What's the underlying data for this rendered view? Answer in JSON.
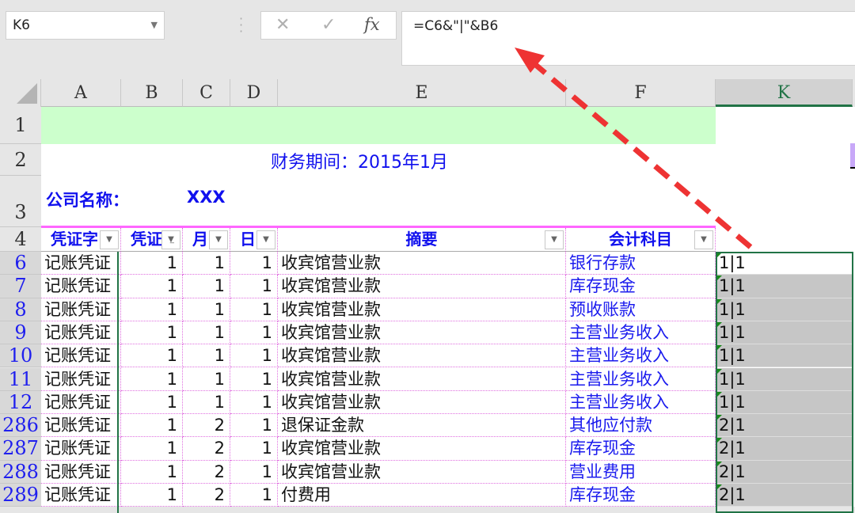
{
  "formula_bar": {
    "name_box": "K6",
    "cancel_icon": "✕",
    "enter_icon": "✓",
    "fx_label": "fx",
    "formula": "=C6&\"|\"&B6"
  },
  "columns": [
    "A",
    "B",
    "C",
    "D",
    "E",
    "F",
    "K"
  ],
  "title_row": {
    "period": "财务期间：2015年1月",
    "company_label": "公司名称：",
    "company_value": "XXX"
  },
  "header_row": {
    "row": "4",
    "cells": [
      "凭证字",
      "凭证",
      "月",
      "日",
      "摘要",
      "会计科目"
    ]
  },
  "colors": {
    "title_text": "#1010ee",
    "row1_fill": "#ccffcc",
    "grid": "#e070e0",
    "selection": "#217346",
    "annotation_arrow": "#ee3333"
  },
  "rows": [
    {
      "row": "6",
      "a": "记账凭证",
      "b": "1",
      "c": "1",
      "d": "1",
      "e": "收宾馆营业款",
      "f": "银行存款",
      "k": "1|1"
    },
    {
      "row": "7",
      "a": "记账凭证",
      "b": "1",
      "c": "1",
      "d": "1",
      "e": "收宾馆营业款",
      "f": "库存现金",
      "k": "1|1"
    },
    {
      "row": "8",
      "a": "记账凭证",
      "b": "1",
      "c": "1",
      "d": "1",
      "e": "收宾馆营业款",
      "f": "预收账款",
      "k": "1|1"
    },
    {
      "row": "9",
      "a": "记账凭证",
      "b": "1",
      "c": "1",
      "d": "1",
      "e": "收宾馆营业款",
      "f": "主营业务收入",
      "k": "1|1"
    },
    {
      "row": "10",
      "a": "记账凭证",
      "b": "1",
      "c": "1",
      "d": "1",
      "e": "收宾馆营业款",
      "f": "主营业务收入",
      "k": "1|1"
    },
    {
      "row": "11",
      "a": "记账凭证",
      "b": "1",
      "c": "1",
      "d": "1",
      "e": "收宾馆营业款",
      "f": "主营业务收入",
      "k": "1|1"
    },
    {
      "row": "12",
      "a": "记账凭证",
      "b": "1",
      "c": "1",
      "d": "1",
      "e": "收宾馆营业款",
      "f": "主营业务收入",
      "k": "1|1"
    },
    {
      "row": "286",
      "a": "记账凭证",
      "b": "1",
      "c": "2",
      "d": "1",
      "e": "退保证金款",
      "f": "其他应付款",
      "k": "2|1"
    },
    {
      "row": "287",
      "a": "记账凭证",
      "b": "1",
      "c": "2",
      "d": "1",
      "e": "收宾馆营业款",
      "f": "库存现金",
      "k": "2|1"
    },
    {
      "row": "288",
      "a": "记账凭证",
      "b": "1",
      "c": "2",
      "d": "1",
      "e": "收宾馆营业款",
      "f": "营业费用",
      "k": "2|1"
    },
    {
      "row": "289",
      "a": "记账凭证",
      "b": "1",
      "c": "2",
      "d": "1",
      "e": "付费用",
      "f": "库存现金",
      "k": "2|1"
    }
  ]
}
